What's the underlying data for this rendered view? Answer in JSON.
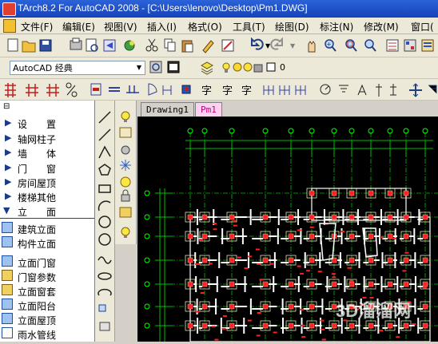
{
  "window": {
    "title": "TArch8.2 For AutoCAD 2008 - [C:\\Users\\lenovo\\Desktop\\Pm1.DWG]"
  },
  "menu": [
    "文件(F)",
    "编辑(E)",
    "视图(V)",
    "插入(I)",
    "格式(O)",
    "工具(T)",
    "绘图(D)",
    "标注(N)",
    "修改(M)",
    "窗口("
  ],
  "toolbar2": {
    "workspace": "AutoCAD 经典",
    "layer_value": "0"
  },
  "sidebar": {
    "items": [
      {
        "label": "设　　置",
        "kind": "arrow"
      },
      {
        "label": "轴网柱子",
        "kind": "arrow"
      },
      {
        "label": "墙　　体",
        "kind": "arrow"
      },
      {
        "label": "门　　窗",
        "kind": "arrow"
      },
      {
        "label": "房间屋顶",
        "kind": "arrow"
      },
      {
        "label": "楼梯其他",
        "kind": "arrow"
      },
      {
        "label": "立　　面",
        "kind": "open"
      },
      {
        "label": "建筑立面",
        "kind": "icon"
      },
      {
        "label": "构件立面",
        "kind": "icon"
      },
      {
        "label": "立面门窗",
        "kind": "icon"
      },
      {
        "label": "门窗参数",
        "kind": "icon"
      },
      {
        "label": "立面窗套",
        "kind": "icon"
      },
      {
        "label": "立面阳台",
        "kind": "icon"
      },
      {
        "label": "立面屋顶",
        "kind": "icon"
      },
      {
        "label": "雨水管线",
        "kind": "icon"
      }
    ]
  },
  "tabs": [
    "Drawing1",
    "Pm1"
  ],
  "active_tab": "Pm1",
  "watermark": "3D溜溜网",
  "colors": {
    "title_bar": "#1f4fc8",
    "canvas": "#000000",
    "grid_line": "#00c000",
    "axis_bubble": "#00ff00",
    "wall": "#ffffff",
    "column": "#ff2020",
    "tab_active": "#ff66cc"
  }
}
